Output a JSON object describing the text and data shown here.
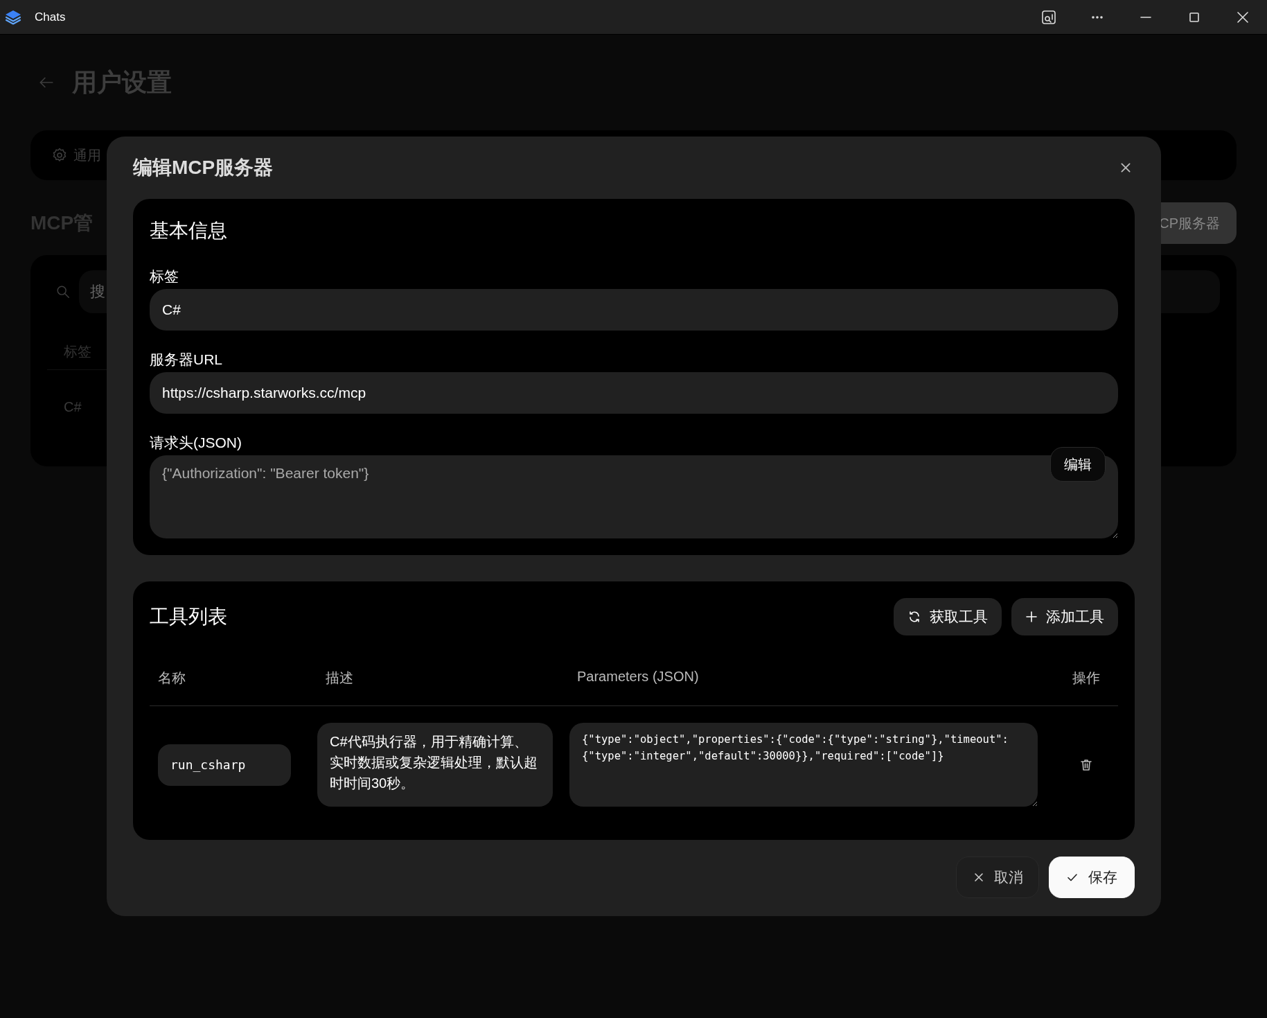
{
  "window": {
    "title": "Chats"
  },
  "page": {
    "title": "用户设置",
    "tab": "通用",
    "section_title": "MCP管",
    "add_button": "CP服务器",
    "search": {
      "placeholder": "搜"
    },
    "column": "标签",
    "row": "C#"
  },
  "dialog": {
    "title": "编辑MCP服务器",
    "basic_info": {
      "title": "基本信息",
      "fields": [
        {
          "label": "标签",
          "value": "C#"
        },
        {
          "label": "服务器URL",
          "value": "https://csharp.starworks.cc/mcp"
        }
      ],
      "headers": {
        "label": "请求头(JSON)",
        "placeholder": "{\"Authorization\": \"Bearer token\"}",
        "edit_button": "编辑"
      }
    },
    "tools": {
      "title": "工具列表",
      "buttons": [
        {
          "kind": "refresh",
          "label": "获取工具"
        },
        {
          "kind": "add",
          "label": "添加工具"
        }
      ],
      "columns": [
        "名称",
        "描述",
        "Parameters (JSON)",
        "操作"
      ],
      "rows": [
        {
          "name": "run_csharp",
          "description": "C#代码执行器，用于精确计算、实时数据或复杂逻辑处理，默认超时时间30秒。",
          "parameters": "{\"type\":\"object\",\"properties\":{\"code\":{\"type\":\"string\"},\"timeout\":{\"type\":\"integer\",\"default\":30000}},\"required\":[\"code\"]}"
        }
      ]
    },
    "footer": [
      {
        "kind": "cancel",
        "label": "取消"
      },
      {
        "kind": "save",
        "label": "保存"
      }
    ]
  }
}
